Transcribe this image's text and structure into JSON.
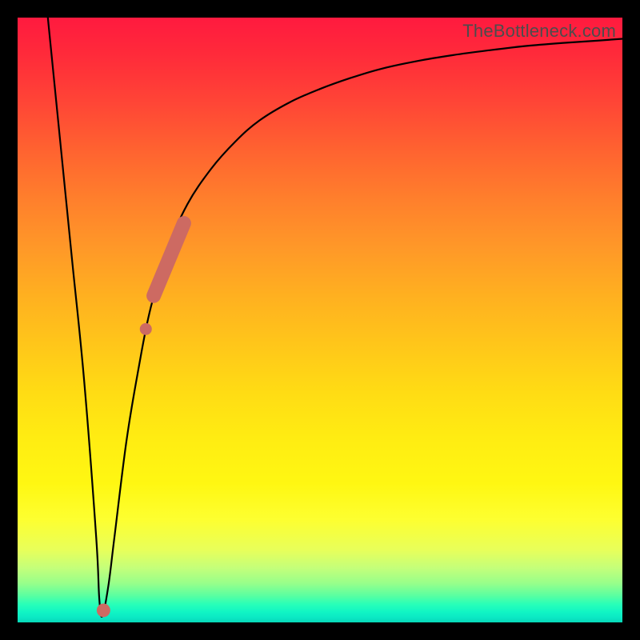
{
  "watermark": "TheBottleneck.com",
  "colors": {
    "frame": "#000000",
    "curve": "#000000",
    "marker": "#cd6a62"
  },
  "chart_data": {
    "type": "line",
    "title": "",
    "xlabel": "",
    "ylabel": "",
    "xlim": [
      0,
      100
    ],
    "ylim": [
      0,
      100
    ],
    "grid": false,
    "legend": false,
    "series": [
      {
        "name": "bottleneck-curve",
        "x": [
          5,
          7,
          9,
          11,
          13,
          13.5,
          14,
          15,
          16,
          18,
          20,
          22,
          25,
          28,
          32,
          36,
          40,
          45,
          50,
          55,
          60,
          66,
          72,
          78,
          84,
          90,
          96,
          100
        ],
        "y": [
          100,
          80,
          60,
          40,
          14,
          4,
          1,
          6,
          14,
          30,
          42,
          52,
          62,
          69,
          75,
          79.5,
          83,
          86,
          88.2,
          90,
          91.5,
          92.8,
          93.8,
          94.6,
          95.3,
          95.8,
          96.2,
          96.5
        ]
      }
    ],
    "markers": [
      {
        "name": "highlight-segment",
        "shape": "thick-line",
        "x": [
          22.5,
          27.5
        ],
        "y": [
          54,
          66
        ]
      },
      {
        "name": "highlight-dot-upper",
        "shape": "dot",
        "x": 21.2,
        "y": 48.5
      },
      {
        "name": "highlight-dot-lower",
        "shape": "dot",
        "x": 14.2,
        "y": 2
      }
    ],
    "background_gradient": {
      "top": "#ff1a3f",
      "mid": "#ffed12",
      "bottom": "#07d8b8"
    }
  }
}
